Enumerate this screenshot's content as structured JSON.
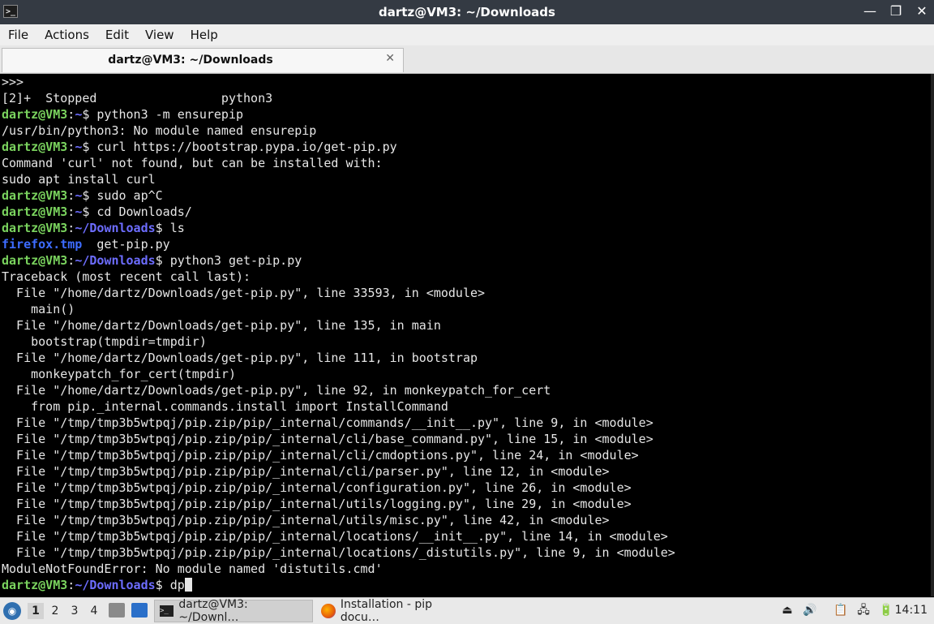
{
  "window": {
    "title": "dartz@VM3: ~/Downloads",
    "app_icon": ">_",
    "controls": {
      "minimize": "—",
      "maximize": "❐",
      "close": "✕"
    }
  },
  "menu": [
    "File",
    "Actions",
    "Edit",
    "View",
    "Help"
  ],
  "tab": {
    "label": "dartz@VM3: ~/Downloads",
    "close": "✕"
  },
  "prompt": {
    "user": "dartz@VM3",
    "colon": ":",
    "home": "~",
    "downloads": "~/Downloads",
    "sign": "$ "
  },
  "terminal": {
    "l1": ">>>",
    "l2": "[2]+  Stopped                 python3",
    "cmd3": "python3 -m ensurepip",
    "l4": "/usr/bin/python3: No module named ensurepip",
    "cmd5": "curl https://bootstrap.pypa.io/get-pip.py",
    "l6": "Command 'curl' not found, but can be installed with:",
    "l7": "sudo apt install curl",
    "cmd8": "sudo ap^C",
    "cmd9": "cd Downloads/",
    "cmd10": "ls",
    "ls_dir": "firefox.tmp",
    "ls_file": "  get-pip.py",
    "cmd12": "python3 get-pip.py",
    "t1": "Traceback (most recent call last):",
    "t2": "  File \"/home/dartz/Downloads/get-pip.py\", line 33593, in <module>",
    "t3": "    main()",
    "t4": "  File \"/home/dartz/Downloads/get-pip.py\", line 135, in main",
    "t5": "    bootstrap(tmpdir=tmpdir)",
    "t6": "  File \"/home/dartz/Downloads/get-pip.py\", line 111, in bootstrap",
    "t7": "    monkeypatch_for_cert(tmpdir)",
    "t8": "  File \"/home/dartz/Downloads/get-pip.py\", line 92, in monkeypatch_for_cert",
    "t9": "    from pip._internal.commands.install import InstallCommand",
    "t10": "  File \"/tmp/tmp3b5wtpqj/pip.zip/pip/_internal/commands/__init__.py\", line 9, in <module>",
    "t11": "  File \"/tmp/tmp3b5wtpqj/pip.zip/pip/_internal/cli/base_command.py\", line 15, in <module>",
    "t12": "  File \"/tmp/tmp3b5wtpqj/pip.zip/pip/_internal/cli/cmdoptions.py\", line 24, in <module>",
    "t13": "  File \"/tmp/tmp3b5wtpqj/pip.zip/pip/_internal/cli/parser.py\", line 12, in <module>",
    "t14": "  File \"/tmp/tmp3b5wtpqj/pip.zip/pip/_internal/configuration.py\", line 26, in <module>",
    "t15": "  File \"/tmp/tmp3b5wtpqj/pip.zip/pip/_internal/utils/logging.py\", line 29, in <module>",
    "t16": "  File \"/tmp/tmp3b5wtpqj/pip.zip/pip/_internal/utils/misc.py\", line 42, in <module>",
    "t17": "  File \"/tmp/tmp3b5wtpqj/pip.zip/pip/_internal/locations/__init__.py\", line 14, in <module>",
    "t18": "  File \"/tmp/tmp3b5wtpqj/pip.zip/pip/_internal/locations/_distutils.py\", line 9, in <module>",
    "t19": "ModuleNotFoundError: No module named 'distutils.cmd'",
    "cmd_last": "dp"
  },
  "taskbar": {
    "workspaces": [
      "1",
      "2",
      "3",
      "4"
    ],
    "tasks": [
      {
        "label": "dartz@VM3: ~/Downl…",
        "icon": "terminal-icon"
      },
      {
        "label": "Installation - pip docu…",
        "icon": "firefox-icon"
      }
    ],
    "clock": "14:11"
  },
  "colors": {
    "user": "#7ad35e",
    "path": "#6d6dff",
    "dir": "#3d6cff",
    "titlebar": "#343a43"
  }
}
